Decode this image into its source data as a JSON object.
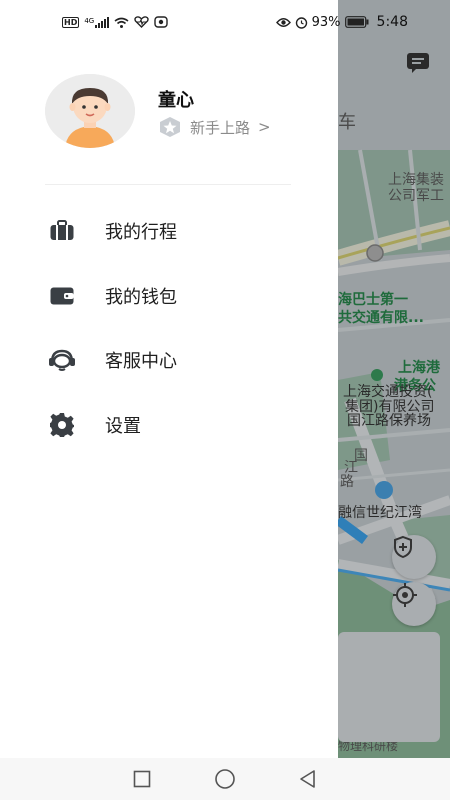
{
  "status_bar": {
    "network_badge": "HD",
    "network_type": "4G",
    "battery": "93%",
    "time": "5:48"
  },
  "map": {
    "top_text": "车",
    "labels": [
      "上海集装",
      "公司军工",
      "海巴士第一",
      "共交通有限...",
      "上海港",
      "港务公",
      "上海交通投资(",
      "集团)有限公司",
      "国江路保养场",
      "国",
      "江",
      "路",
      "融信世纪江湾",
      "物理科研楼"
    ]
  },
  "drawer": {
    "user": {
      "name": "童心",
      "level": "新手上路",
      "level_chevron": ">"
    },
    "menu": [
      {
        "label": "我的行程",
        "icon": "luggage-icon"
      },
      {
        "label": "我的钱包",
        "icon": "wallet-icon"
      },
      {
        "label": "客服中心",
        "icon": "headset-icon"
      },
      {
        "label": "设置",
        "icon": "gear-icon"
      }
    ]
  },
  "nav_bar": {
    "buttons": [
      "recents-square-icon",
      "home-circle-icon",
      "back-triangle-icon"
    ]
  }
}
